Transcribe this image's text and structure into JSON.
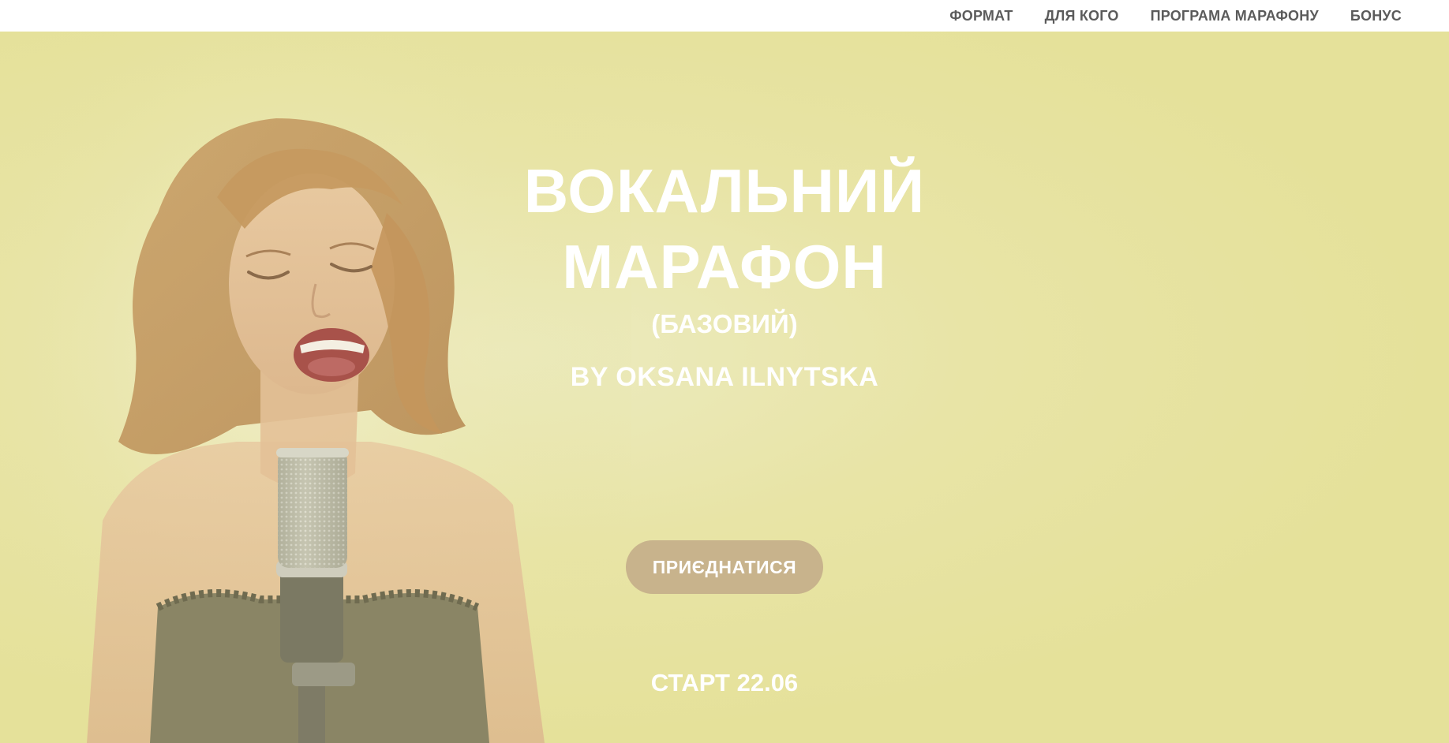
{
  "nav": {
    "items": [
      {
        "label": "ФОРМАТ"
      },
      {
        "label": "ДЛЯ КОГО"
      },
      {
        "label": "ПРОГРАМА МАРАФОНУ"
      },
      {
        "label": "БОНУС"
      }
    ]
  },
  "hero": {
    "title_line1": "ВОКАЛЬНИЙ",
    "title_line2": "МАРАФОН",
    "subtitle": "(БАЗОВИЙ)",
    "author": "BY OKSANA ILNYTSKA",
    "cta_label": "ПРИЄДНАТИСЯ",
    "start_text": "СТАРТ 22.06"
  },
  "colors": {
    "background": "#e5e19a",
    "nav_text": "#5b5b5b",
    "button": "#c8b38c",
    "text": "#ffffff"
  }
}
